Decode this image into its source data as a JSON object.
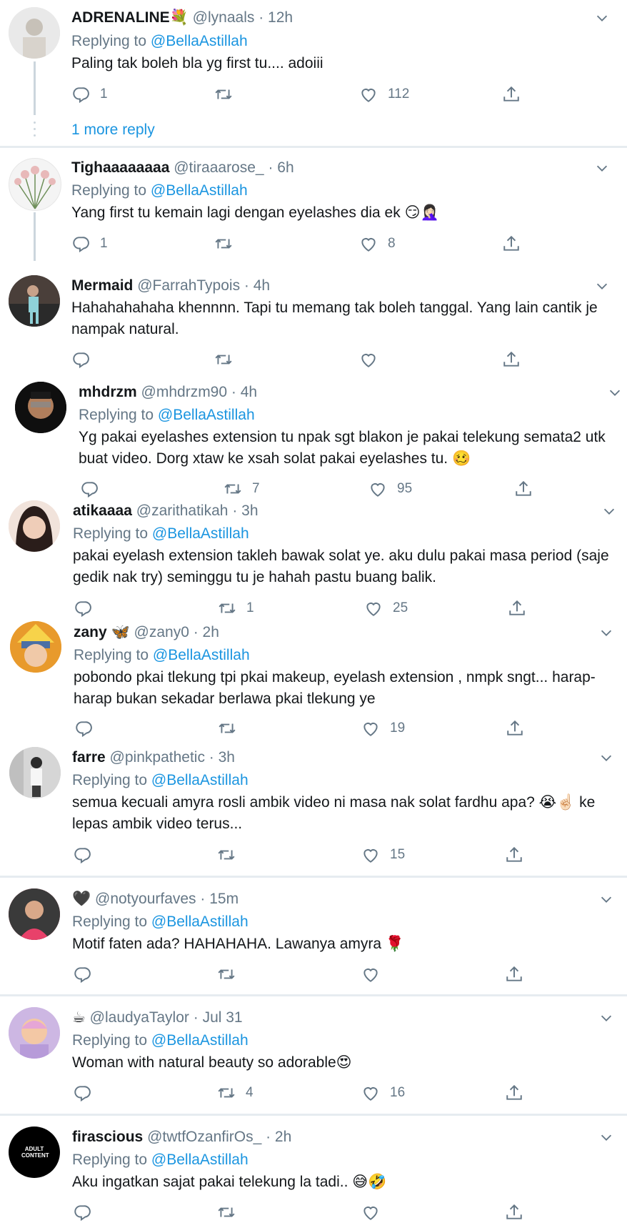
{
  "tweets": [
    {
      "name": "ADRENALINE💐",
      "handle": "@lynaals",
      "time": "12h",
      "replying_label": "Replying to",
      "replying_to": "@BellaAstillah",
      "text": "Paling tak boleh bla yg first tu.... adoiii",
      "replies": "1",
      "retweets": "",
      "likes": "112"
    },
    {
      "name": "Tighaaaaaaaa",
      "handle": "@tiraaarose_",
      "time": "6h",
      "replying_label": "Replying to",
      "replying_to": "@BellaAstillah",
      "text": "Yang first tu kemain lagi dengan eyelashes dia ek 😏🤦🏻‍♀️",
      "replies": "1",
      "retweets": "",
      "likes": "8"
    },
    {
      "name": "Mermaid",
      "handle": "@FarrahTypois",
      "time": "4h",
      "text": "Hahahahahaha khennnn. Tapi tu memang tak boleh tanggal. Yang lain cantik je nampak natural.",
      "replies": "",
      "retweets": "",
      "likes": ""
    },
    {
      "name": "mhdrzm",
      "handle": "@mhdrzm90",
      "time": "4h",
      "replying_label": "Replying to",
      "replying_to": "@BellaAstillah",
      "text": "Yg pakai eyelashes extension tu npak sgt blakon je pakai telekung semata2 utk buat video. Dorg xtaw ke xsah solat pakai eyelashes tu. 🥴",
      "replies": "",
      "retweets": "7",
      "likes": "95"
    },
    {
      "name": "atikaaaa",
      "handle": "@zarithatikah",
      "time": "3h",
      "replying_label": "Replying to",
      "replying_to": "@BellaAstillah",
      "text": "pakai eyelash extension takleh bawak solat ye. aku dulu pakai masa period (saje gedik nak try) seminggu tu je hahah pastu buang balik.",
      "replies": "",
      "retweets": "1",
      "likes": "25"
    },
    {
      "name": "zany 🦋",
      "handle": "@zany0",
      "time": "2h",
      "replying_label": "Replying to",
      "replying_to": "@BellaAstillah",
      "text": "pobondo pkai tlekung tpi pkai makeup, eyelash extension , nmpk sngt... harap-harap bukan sekadar berlawa pkai tlekung ye",
      "replies": "",
      "retweets": "",
      "likes": "19"
    },
    {
      "name": "farre",
      "handle": "@pinkpathetic",
      "time": "3h",
      "replying_label": "Replying to",
      "replying_to": "@BellaAstillah",
      "text": "semua kecuali amyra rosli ambik video ni masa nak solat fardhu apa? 😭☝🏻 ke lepas ambik video terus...",
      "replies": "",
      "retweets": "",
      "likes": "15"
    },
    {
      "name": "🖤",
      "handle": "@notyourfaves",
      "time": "15m",
      "replying_label": "Replying to",
      "replying_to": "@BellaAstillah",
      "text": "Motif faten ada? HAHAHAHA. Lawanya amyra 🌹",
      "replies": "",
      "retweets": "",
      "likes": ""
    },
    {
      "name": "☕",
      "handle": "@laudyaTaylor",
      "time": "Jul 31",
      "replying_label": "Replying to",
      "replying_to": "@BellaAstillah",
      "text": "Woman with natural beauty so adorable😍",
      "replies": "",
      "retweets": "4",
      "likes": "16"
    },
    {
      "name": "firascious",
      "handle": "@twtfOzanfirOs_",
      "time": "2h",
      "replying_label": "Replying to",
      "replying_to": "@BellaAstillah",
      "text": "Aku ingatkan sajat pakai telekung la tadi.. 😅🤣",
      "replies": "",
      "retweets": "",
      "likes": ""
    }
  ],
  "more_reply": "1 more reply",
  "avatar_4_text": "ADULT CONTENT",
  "icons": [
    "reply-icon",
    "retweet-icon",
    "like-icon",
    "share-icon",
    "chevron-down-icon"
  ],
  "colors": {
    "link": "#1b95e0",
    "muted": "#657786",
    "divider": "#e6ecf0"
  }
}
